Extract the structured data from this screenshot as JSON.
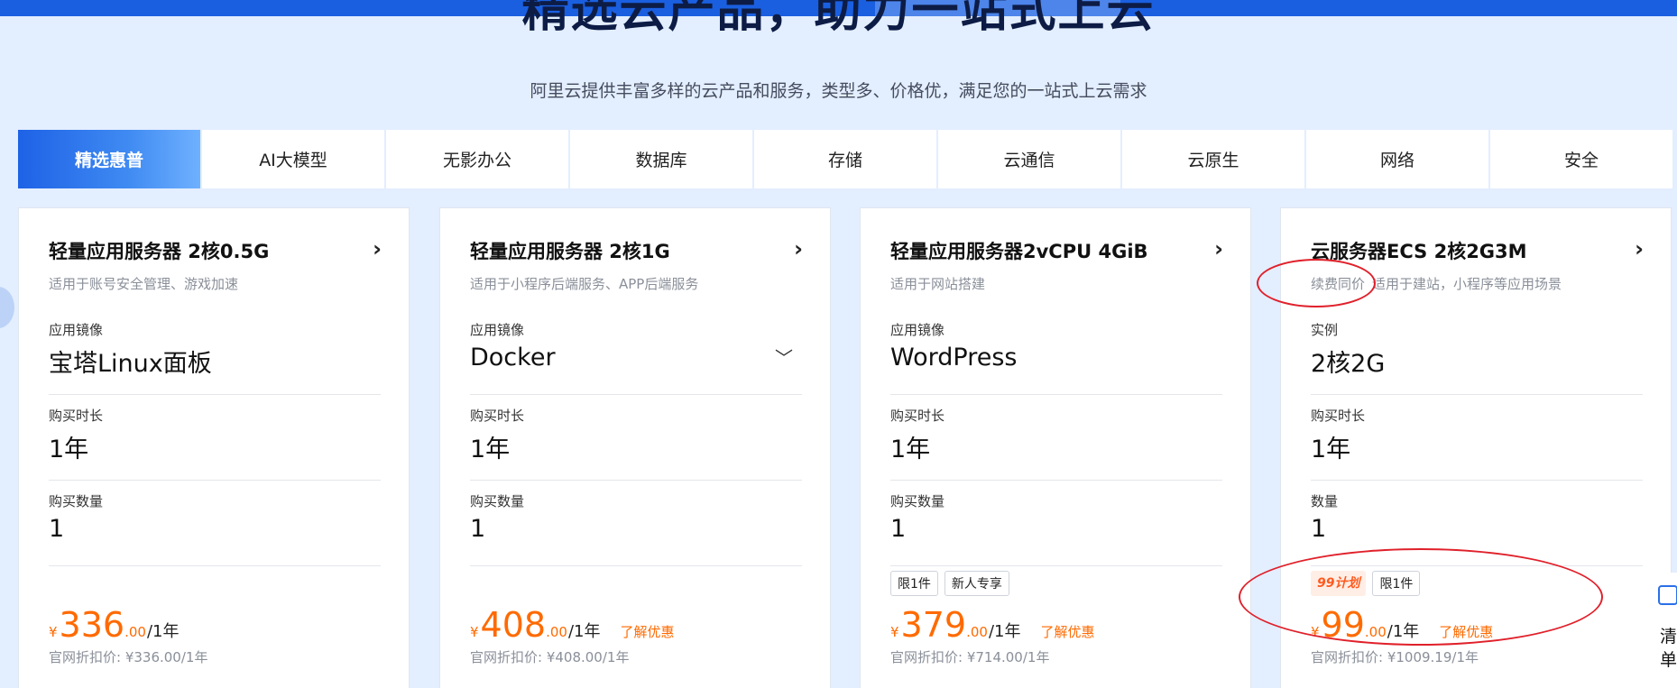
{
  "hero": {
    "title": "精选云产品，助力一站式上云",
    "subtitle": "阿里云提供丰富多样的云产品和服务，类型多、价格优，满足您的一站式上云需求"
  },
  "tabs": [
    {
      "label": "精选惠普",
      "active": true
    },
    {
      "label": "AI大模型"
    },
    {
      "label": "无影办公"
    },
    {
      "label": "数据库"
    },
    {
      "label": "存储"
    },
    {
      "label": "云通信"
    },
    {
      "label": "云原生"
    },
    {
      "label": "网络"
    },
    {
      "label": "安全"
    }
  ],
  "cards": [
    {
      "title": "轻量应用服务器 2核0.5G",
      "desc": "适用于账号安全管理、游戏加速",
      "fields": [
        {
          "label": "应用镜像",
          "value": "宝塔Linux面板"
        },
        {
          "label": "购买时长",
          "value": "1年"
        },
        {
          "label": "购买数量",
          "value": "1"
        }
      ],
      "price": {
        "currency": "¥",
        "int": "336",
        "dec": ".00",
        "unit": "/1年"
      },
      "original": "官网折扣价: ¥336.00/1年"
    },
    {
      "title": "轻量应用服务器 2核1G",
      "desc": "适用于小程序后端服务、APP后端服务",
      "fields": [
        {
          "label": "应用镜像",
          "value": "Docker",
          "dropdown": "chevron-down"
        },
        {
          "label": "购买时长",
          "value": "1年"
        },
        {
          "label": "购买数量",
          "value": "1"
        }
      ],
      "price": {
        "currency": "¥",
        "int": "408",
        "dec": ".00",
        "unit": "/1年",
        "promo": "了解优惠"
      },
      "original": "官网折扣价: ¥408.00/1年"
    },
    {
      "title": "轻量应用服务器2vCPU 4GiB",
      "desc": "适用于网站搭建",
      "fields": [
        {
          "label": "应用镜像",
          "value": "WordPress"
        },
        {
          "label": "购买时长",
          "value": "1年"
        },
        {
          "label": "购买数量",
          "value": "1"
        }
      ],
      "tags": [
        "限1件",
        "新人专享"
      ],
      "price": {
        "currency": "¥",
        "int": "379",
        "dec": ".00",
        "unit": "/1年",
        "promo": "了解优惠"
      },
      "original": "官网折扣价: ¥714.00/1年"
    },
    {
      "title": "云服务器ECS 2核2G3M",
      "desc_highlight": "续费同价",
      "desc": "适用于建站，小程序等应用场景",
      "fields": [
        {
          "label": "实例",
          "value": "2核2G"
        },
        {
          "label": "购买时长",
          "value": "1年"
        },
        {
          "label": "数量",
          "value": "1"
        }
      ],
      "plan_tag": "99计划",
      "tags": [
        "限1件"
      ],
      "price": {
        "currency": "¥",
        "int": "99",
        "dec": ".00",
        "unit": "/1年",
        "promo": "了解优惠"
      },
      "original": "官网折扣价: ¥1009.19/1年"
    }
  ],
  "side_widget": {
    "line1": "清",
    "line2": "单"
  },
  "colors": {
    "accent": "#1e62e6",
    "price": "#ff6a00",
    "annotation": "#e0202a",
    "background": "#e3eeff"
  }
}
